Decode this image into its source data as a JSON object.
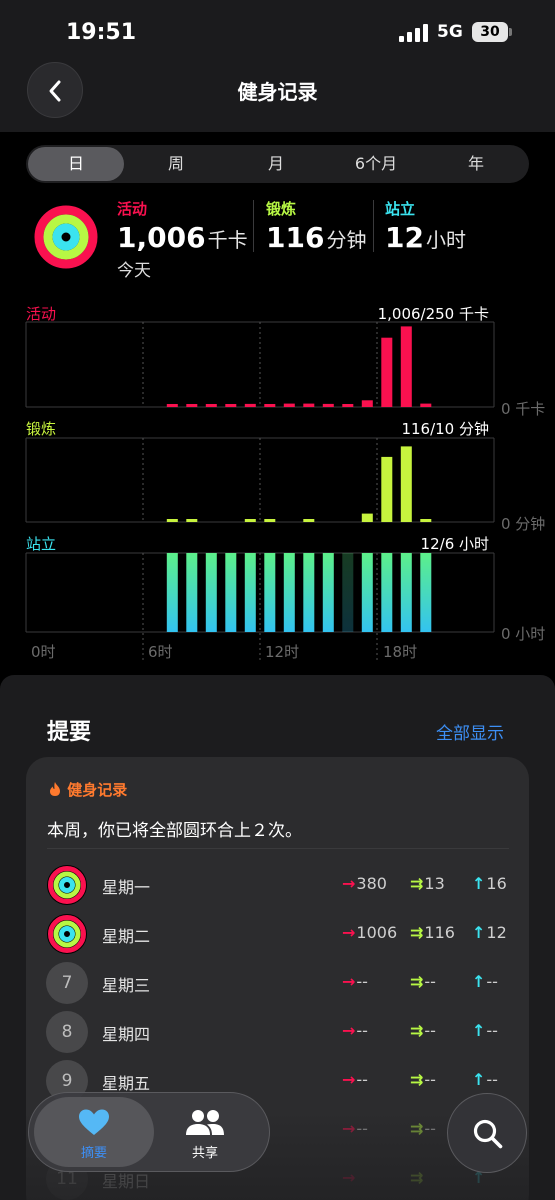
{
  "status_bar": {
    "time": "19:51",
    "network": "5G",
    "battery": "30"
  },
  "nav": {
    "title": "健身记录"
  },
  "segments": [
    "日",
    "周",
    "月",
    "6个月",
    "年"
  ],
  "segment_selected": 0,
  "summary": {
    "move": {
      "label": "活动",
      "value": "1,006",
      "unit": "千卡",
      "sub": "今天",
      "color": "#fa114f"
    },
    "exercise": {
      "label": "锻炼",
      "value": "116",
      "unit": "分钟",
      "color": "#b7f744"
    },
    "stand": {
      "label": "站立",
      "value": "12",
      "unit": "小时",
      "color": "#3be3ef"
    }
  },
  "chart_data": [
    {
      "type": "bar",
      "title": "活动",
      "goal_text": "1,006/250 千卡",
      "zero_label": "0 千卡",
      "x": [
        0,
        1,
        2,
        3,
        4,
        5,
        6,
        7,
        8,
        9,
        10,
        11,
        12,
        13,
        14,
        15,
        16,
        17,
        18,
        19,
        20,
        21,
        22,
        23
      ],
      "values": [
        0,
        0,
        0,
        0,
        0,
        0,
        0,
        6,
        4,
        13,
        12,
        15,
        12,
        16,
        16,
        15,
        9,
        32,
        330,
        384,
        16,
        0,
        0,
        0
      ],
      "ylim": [
        0,
        400
      ],
      "color": "#fa114f"
    },
    {
      "type": "bar",
      "title": "锻炼",
      "goal_text": "116/10 分钟",
      "zero_label": "0 分钟",
      "x": [
        0,
        1,
        2,
        3,
        4,
        5,
        6,
        7,
        8,
        9,
        10,
        11,
        12,
        13,
        14,
        15,
        16,
        17,
        18,
        19,
        20,
        21,
        22,
        23
      ],
      "values": [
        0,
        0,
        0,
        0,
        0,
        0,
        0,
        1,
        1,
        0,
        0,
        1,
        1,
        0,
        1,
        0,
        0,
        4,
        31,
        36,
        1,
        0,
        0,
        0
      ],
      "ylim": [
        0,
        40
      ],
      "color": "#c7f33e"
    },
    {
      "type": "bar",
      "title": "站立",
      "goal_text": "12/6 小时",
      "zero_label": "0 小时",
      "x": [
        0,
        1,
        2,
        3,
        4,
        5,
        6,
        7,
        8,
        9,
        10,
        11,
        12,
        13,
        14,
        15,
        16,
        17,
        18,
        19,
        20,
        21,
        22,
        23
      ],
      "values": [
        0,
        0,
        0,
        0,
        0,
        0,
        0,
        1,
        1,
        1,
        1,
        1,
        1,
        1,
        1,
        1,
        0.5,
        1,
        1,
        1,
        1,
        0,
        0,
        0
      ],
      "ylim": [
        0,
        1
      ],
      "color": "#47e6c8",
      "xtick_labels": [
        "0时",
        "6时",
        "12时",
        "18时"
      ]
    }
  ],
  "summary_section": {
    "heading": "提要",
    "show_all": "全部显示",
    "card_tag": "健身记录",
    "card_desc": "本周，你已将全部圆环合上２次。",
    "days": [
      {
        "badge": "",
        "day": "星期一",
        "move": "380",
        "exercise": "13",
        "stand": "16",
        "rings": true
      },
      {
        "badge": "",
        "day": "星期二",
        "move": "1006",
        "exercise": "116",
        "stand": "12",
        "rings": true
      },
      {
        "badge": "7",
        "day": "星期三",
        "move": "--",
        "exercise": "--",
        "stand": "--",
        "rings": false
      },
      {
        "badge": "8",
        "day": "星期四",
        "move": "--",
        "exercise": "--",
        "stand": "--",
        "rings": false
      },
      {
        "badge": "9",
        "day": "星期五",
        "move": "--",
        "exercise": "--",
        "stand": "--",
        "rings": false
      },
      {
        "badge": "",
        "day": "",
        "move": "--",
        "exercise": "--",
        "stand": "--",
        "rings": false
      },
      {
        "badge": "11",
        "day": "星期日",
        "move": "",
        "exercise": "",
        "stand": "",
        "rings": false
      }
    ]
  },
  "tabbar": {
    "summary_label": "摘要",
    "sharing_label": "共享"
  },
  "colors": {
    "move": "#fa114f",
    "exercise": "#b7f744",
    "stand": "#3be3ef",
    "accent": "#3d8ff5"
  }
}
